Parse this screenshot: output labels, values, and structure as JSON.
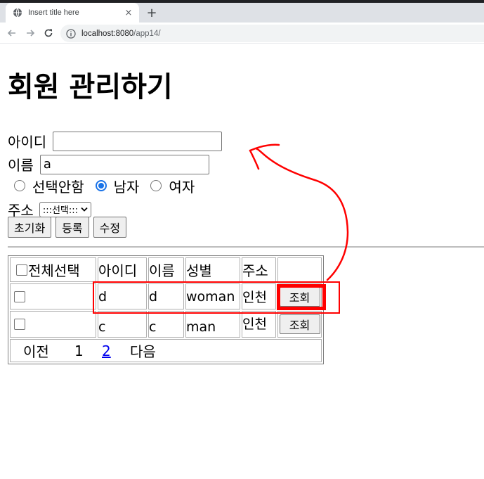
{
  "browser": {
    "tab_title": "Insert title here",
    "tab_close": "×",
    "new_tab": "+",
    "url_host": "localhost:8080",
    "url_path": "/app14/",
    "icons": [
      "globe-icon",
      "close-icon",
      "plus-icon",
      "back-arrow-icon",
      "forward-arrow-icon",
      "reload-icon",
      "info-icon"
    ]
  },
  "page": {
    "title": "회원 관리하기"
  },
  "form": {
    "id_label": "아이디",
    "id_value": "",
    "name_label": "이름",
    "name_value": "a",
    "gender_options": [
      "선택안함",
      "남자",
      "여자"
    ],
    "gender_selected": "남자",
    "address_label": "주소",
    "address_selected": ":::선택:::",
    "buttons": {
      "reset": "초기화",
      "register": "등록",
      "modify": "수정"
    }
  },
  "table": {
    "headers": {
      "select_all": "전체선택",
      "id": "아이디",
      "name": "이름",
      "gender": "성별",
      "address": "주소",
      "action": ""
    },
    "rows": [
      {
        "id": "d",
        "name": "d",
        "gender": "woman",
        "address": "인천",
        "action": "조회"
      },
      {
        "id": "c",
        "name": "c",
        "gender": "man",
        "address": "인천",
        "action": "조회"
      }
    ],
    "pager": {
      "prev": "이전",
      "pages": [
        "1",
        "2"
      ],
      "current_link": "2",
      "next": "다음"
    }
  },
  "annotation": {
    "color": "#ff0000"
  }
}
